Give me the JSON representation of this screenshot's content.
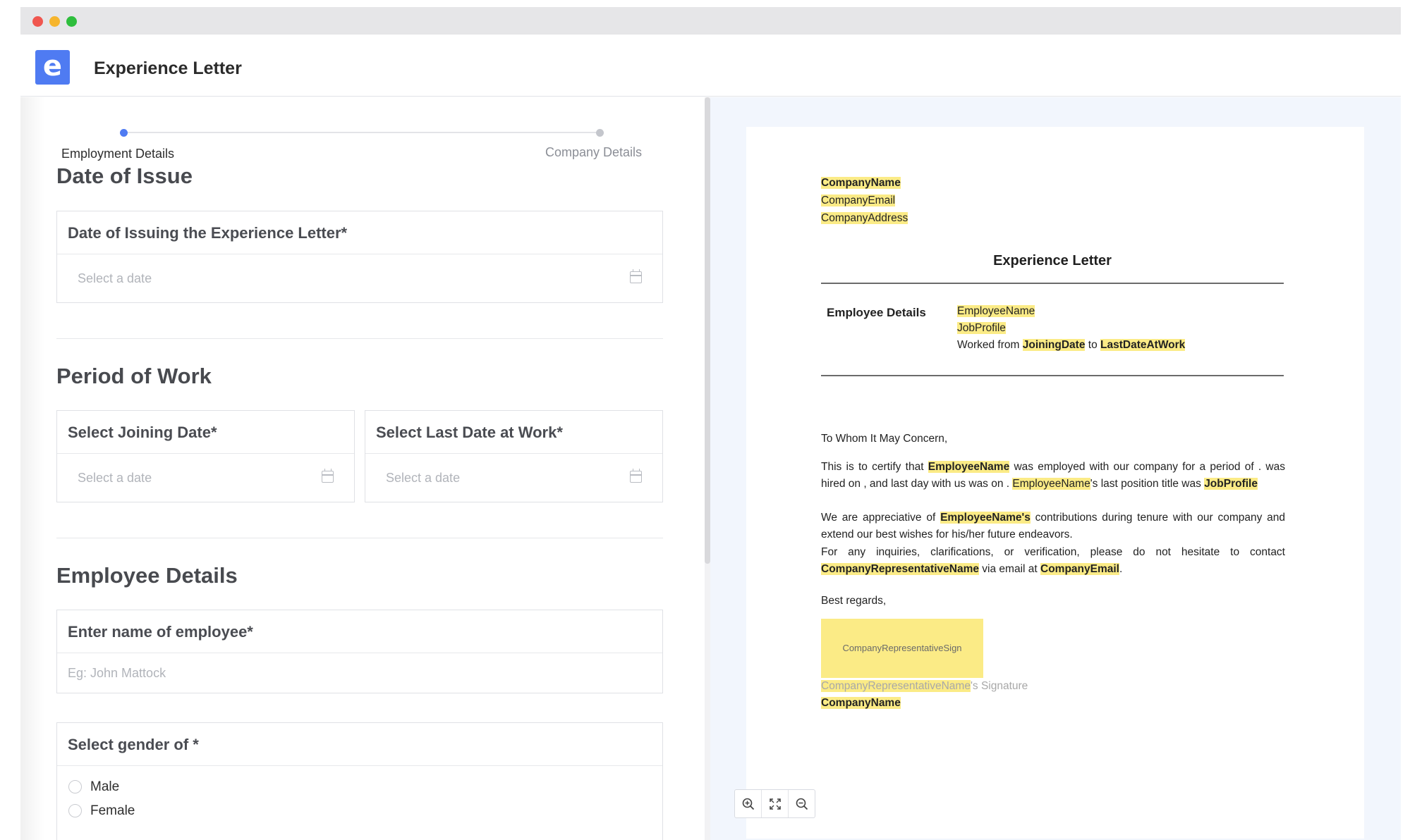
{
  "app": {
    "title": "Experience Letter",
    "logo_letter": "e"
  },
  "stepper": {
    "steps": [
      {
        "label": "Employment Details",
        "active": true
      },
      {
        "label": "Company Details",
        "active": false
      }
    ]
  },
  "form": {
    "sections": {
      "date_of_issue": "Date of Issue",
      "period_of_work": "Period of Work",
      "employee_details": "Employee Details"
    },
    "issue_date": {
      "label": "Date of Issuing the Experience Letter*",
      "placeholder": "Select a date"
    },
    "joining_date": {
      "label": "Select Joining Date*",
      "placeholder": "Select a date"
    },
    "last_date": {
      "label": "Select Last Date at Work*",
      "placeholder": "Select a date"
    },
    "employee_name": {
      "label": "Enter name of employee*",
      "placeholder": "Eg: John Mattock"
    },
    "gender": {
      "label": "Select gender of *",
      "options": [
        "Male",
        "Female"
      ]
    }
  },
  "preview": {
    "company_name": "CompanyName",
    "company_email": "CompanyEmail",
    "company_address": "CompanyAddress",
    "title": "Experience Letter",
    "employee_details_label": "Employee Details",
    "employee_name": "EmployeeName",
    "job_profile": "JobProfile",
    "worked_from": "Worked from",
    "joining_date": "JoiningDate",
    "to": "to",
    "last_date": "LastDateAtWork",
    "salutation": "To Whom It May Concern,",
    "para1": {
      "a": "This is to certify that",
      "name": "EmployeeName",
      "b": "was employed with our company for a period of .  was hired on , and  last day with us was on .",
      "name2": "EmployeeName",
      "c": "'s last position title was",
      "job": "JobProfile"
    },
    "para2": {
      "a": "We are appreciative of",
      "name": "EmployeeName's",
      "b": "contributions during  tenure with our company and extend our best wishes for his/her future endeavors."
    },
    "para3": {
      "a": "For any inquiries, clarifications, or verification, please do not hesitate to contact",
      "rep": "CompanyRepresentativeName",
      "b": "via email at",
      "email": "CompanyEmail",
      "c": "."
    },
    "closing": "Best regards,",
    "sign_placeholder": "CompanyRepresentativeSign",
    "sign_rep": "CompanyRepresentativeName",
    "sign_suffix": "'s Signature",
    "sign_company": "CompanyName"
  },
  "zoom": {
    "buttons": [
      "zoom-in-icon",
      "fit-screen-icon",
      "zoom-out-icon"
    ]
  },
  "colors": {
    "accent": "#4f7bf2",
    "highlight": "#fbeb86",
    "preview_bg": "#f2f6fd"
  }
}
